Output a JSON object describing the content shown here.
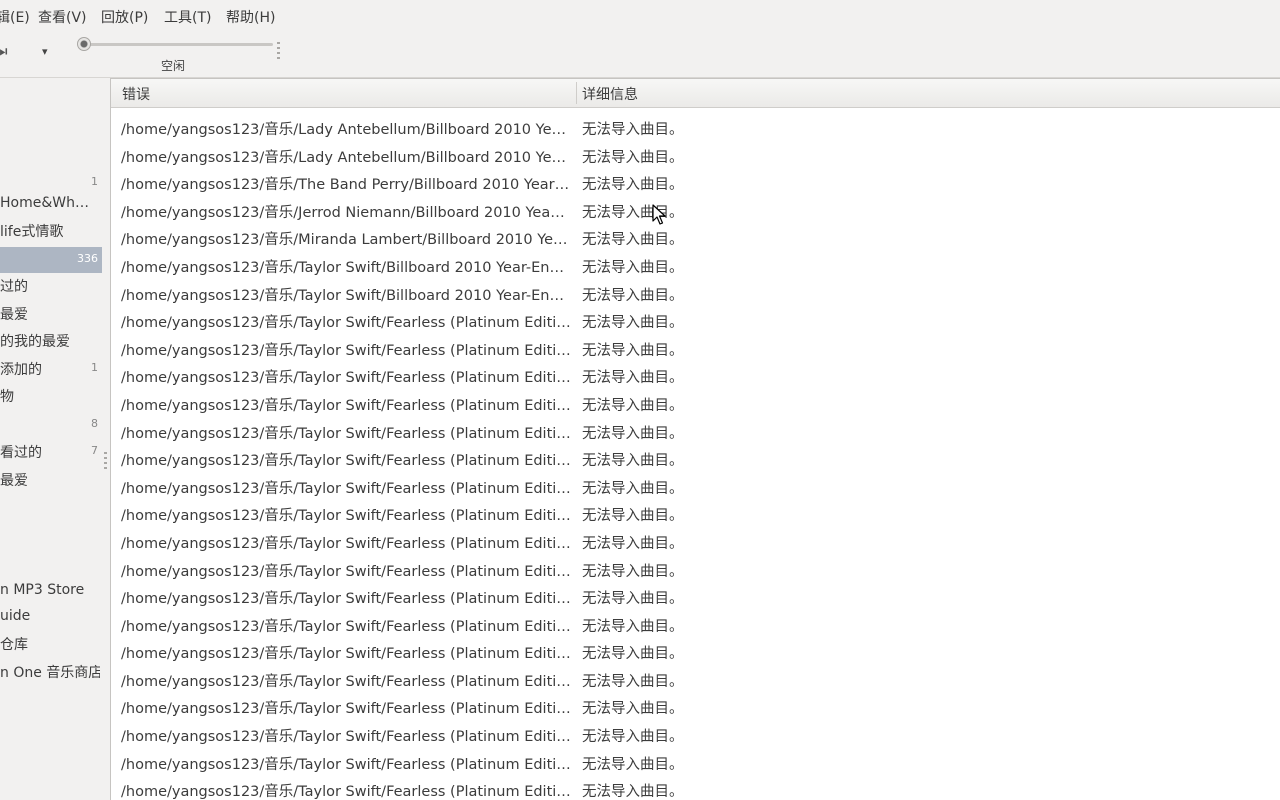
{
  "menu": [
    {
      "label": "辑(E)"
    },
    {
      "label": "查看(V)"
    },
    {
      "label": "回放(P)"
    },
    {
      "label": "工具(T)"
    },
    {
      "label": "帮助(H)"
    }
  ],
  "toolbar": {
    "next_icon": "⏭",
    "dropdown_icon": "▾",
    "status": "空闲",
    "position_fraction": 0.0
  },
  "sidebar": {
    "items": [
      {
        "label": "",
        "count": "1"
      },
      {
        "label": "Home&Wh…",
        "count": ""
      },
      {
        "label": "life式情歌",
        "count": ""
      },
      {
        "label": "",
        "count": "336",
        "selected": true
      },
      {
        "label": "过的",
        "count": ""
      },
      {
        "label": "最爱",
        "count": ""
      },
      {
        "label": "的我的最爱",
        "count": ""
      },
      {
        "label": "添加的",
        "count": "1"
      },
      {
        "label": "物",
        "count": ""
      },
      {
        "label": "",
        "count": "8"
      },
      {
        "label": "看过的",
        "count": "7"
      },
      {
        "label": "最爱",
        "count": ""
      },
      {
        "label": "n MP3 Store",
        "count": ""
      },
      {
        "label": "uide",
        "count": ""
      },
      {
        "label": "仓库",
        "count": ""
      },
      {
        "label": "n One 音乐商店",
        "count": ""
      }
    ]
  },
  "table": {
    "columns": [
      "错误",
      "详细信息"
    ],
    "rows": [
      {
        "path": "/home/yangsos123/音乐/Lady Antebellum/Billboard 2010 Ye…",
        "detail": "无法导入曲目。"
      },
      {
        "path": "/home/yangsos123/音乐/Lady Antebellum/Billboard 2010 Ye…",
        "detail": "无法导入曲目。"
      },
      {
        "path": "/home/yangsos123/音乐/The Band Perry/Billboard 2010 Year…",
        "detail": "无法导入曲目。"
      },
      {
        "path": "/home/yangsos123/音乐/Jerrod Niemann/Billboard 2010 Yea…",
        "detail": "无法导入曲目。"
      },
      {
        "path": "/home/yangsos123/音乐/Miranda Lambert/Billboard 2010 Ye…",
        "detail": "无法导入曲目。"
      },
      {
        "path": "/home/yangsos123/音乐/Taylor Swift/Billboard 2010 Year-En…",
        "detail": "无法导入曲目。"
      },
      {
        "path": "/home/yangsos123/音乐/Taylor Swift/Billboard 2010 Year-En…",
        "detail": "无法导入曲目。"
      },
      {
        "path": "/home/yangsos123/音乐/Taylor Swift/Fearless (Platinum Editi…",
        "detail": "无法导入曲目。"
      },
      {
        "path": "/home/yangsos123/音乐/Taylor Swift/Fearless (Platinum Editi…",
        "detail": "无法导入曲目。"
      },
      {
        "path": "/home/yangsos123/音乐/Taylor Swift/Fearless (Platinum Editi…",
        "detail": "无法导入曲目。"
      },
      {
        "path": "/home/yangsos123/音乐/Taylor Swift/Fearless (Platinum Editi…",
        "detail": "无法导入曲目。"
      },
      {
        "path": "/home/yangsos123/音乐/Taylor Swift/Fearless (Platinum Editi…",
        "detail": "无法导入曲目。"
      },
      {
        "path": "/home/yangsos123/音乐/Taylor Swift/Fearless (Platinum Editi…",
        "detail": "无法导入曲目。"
      },
      {
        "path": "/home/yangsos123/音乐/Taylor Swift/Fearless (Platinum Editi…",
        "detail": "无法导入曲目。"
      },
      {
        "path": "/home/yangsos123/音乐/Taylor Swift/Fearless (Platinum Editi…",
        "detail": "无法导入曲目。"
      },
      {
        "path": "/home/yangsos123/音乐/Taylor Swift/Fearless (Platinum Editi…",
        "detail": "无法导入曲目。"
      },
      {
        "path": "/home/yangsos123/音乐/Taylor Swift/Fearless (Platinum Editi…",
        "detail": "无法导入曲目。"
      },
      {
        "path": "/home/yangsos123/音乐/Taylor Swift/Fearless (Platinum Editi…",
        "detail": "无法导入曲目。"
      },
      {
        "path": "/home/yangsos123/音乐/Taylor Swift/Fearless (Platinum Editi…",
        "detail": "无法导入曲目。"
      },
      {
        "path": "/home/yangsos123/音乐/Taylor Swift/Fearless (Platinum Editi…",
        "detail": "无法导入曲目。"
      },
      {
        "path": "/home/yangsos123/音乐/Taylor Swift/Fearless (Platinum Editi…",
        "detail": "无法导入曲目。"
      },
      {
        "path": "/home/yangsos123/音乐/Taylor Swift/Fearless (Platinum Editi…",
        "detail": "无法导入曲目。"
      },
      {
        "path": "/home/yangsos123/音乐/Taylor Swift/Fearless (Platinum Editi…",
        "detail": "无法导入曲目。"
      },
      {
        "path": "/home/yangsos123/音乐/Taylor Swift/Fearless (Platinum Editi…",
        "detail": "无法导入曲目。"
      },
      {
        "path": "/home/yangsos123/音乐/Taylor Swift/Fearless (Platinum Editi…",
        "detail": "无法导入曲目。"
      }
    ]
  },
  "colors": {
    "selection": "#adb6c3",
    "background": "#f2f1f0",
    "list_background": "#ffffff"
  }
}
